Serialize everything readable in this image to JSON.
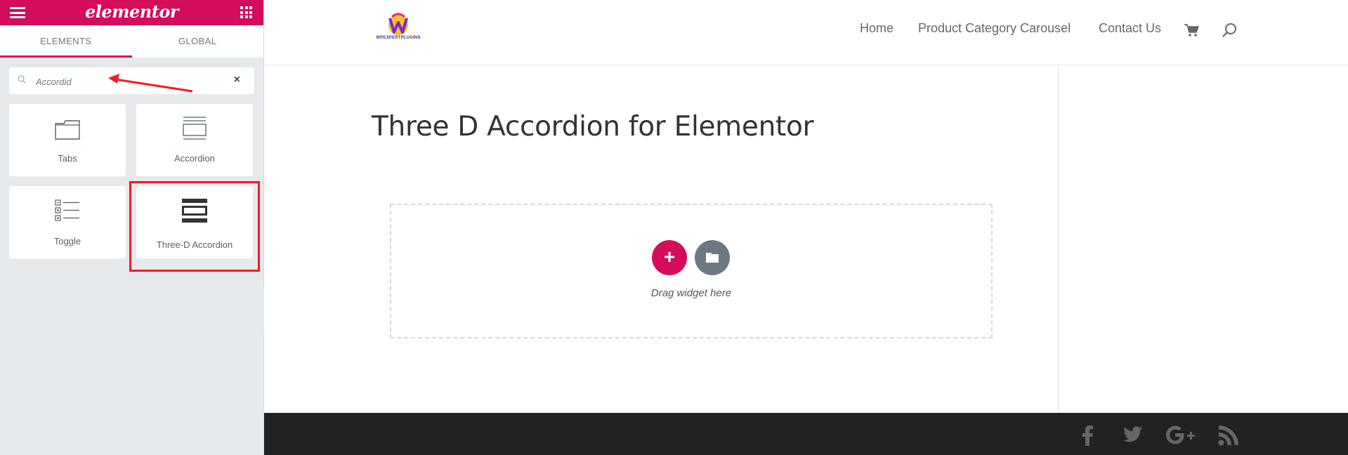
{
  "panel": {
    "logo_text": "elementor",
    "tabs": [
      {
        "label": "ELEMENTS",
        "active": true
      },
      {
        "label": "GLOBAL",
        "active": false
      }
    ],
    "search": {
      "value": "Accordid",
      "clear_symbol": "×"
    },
    "widgets": [
      {
        "label": "Tabs",
        "icon": "tabs-icon"
      },
      {
        "label": "Accordion",
        "icon": "accordion-icon"
      },
      {
        "label": "Toggle",
        "icon": "toggle-icon"
      },
      {
        "label": "Three-D Accordion",
        "icon": "three-d-accordion-icon",
        "highlighted": true
      }
    ],
    "accent_color": "#d30c5c",
    "annotation_color": "#ee1c25"
  },
  "site": {
    "logo_text": "WPEXPERTPLUGINS",
    "nav": [
      {
        "label": "Home"
      },
      {
        "label": "Product Category Carousel"
      },
      {
        "label": "Contact Us"
      }
    ],
    "page_title": "Three D Accordion for Elementor",
    "drop_zone": {
      "add_symbol": "+",
      "drag_text": "Drag widget here"
    },
    "footer": {
      "social_icons": [
        "facebook-icon",
        "twitter-icon",
        "google-plus-icon",
        "rss-icon"
      ]
    }
  }
}
